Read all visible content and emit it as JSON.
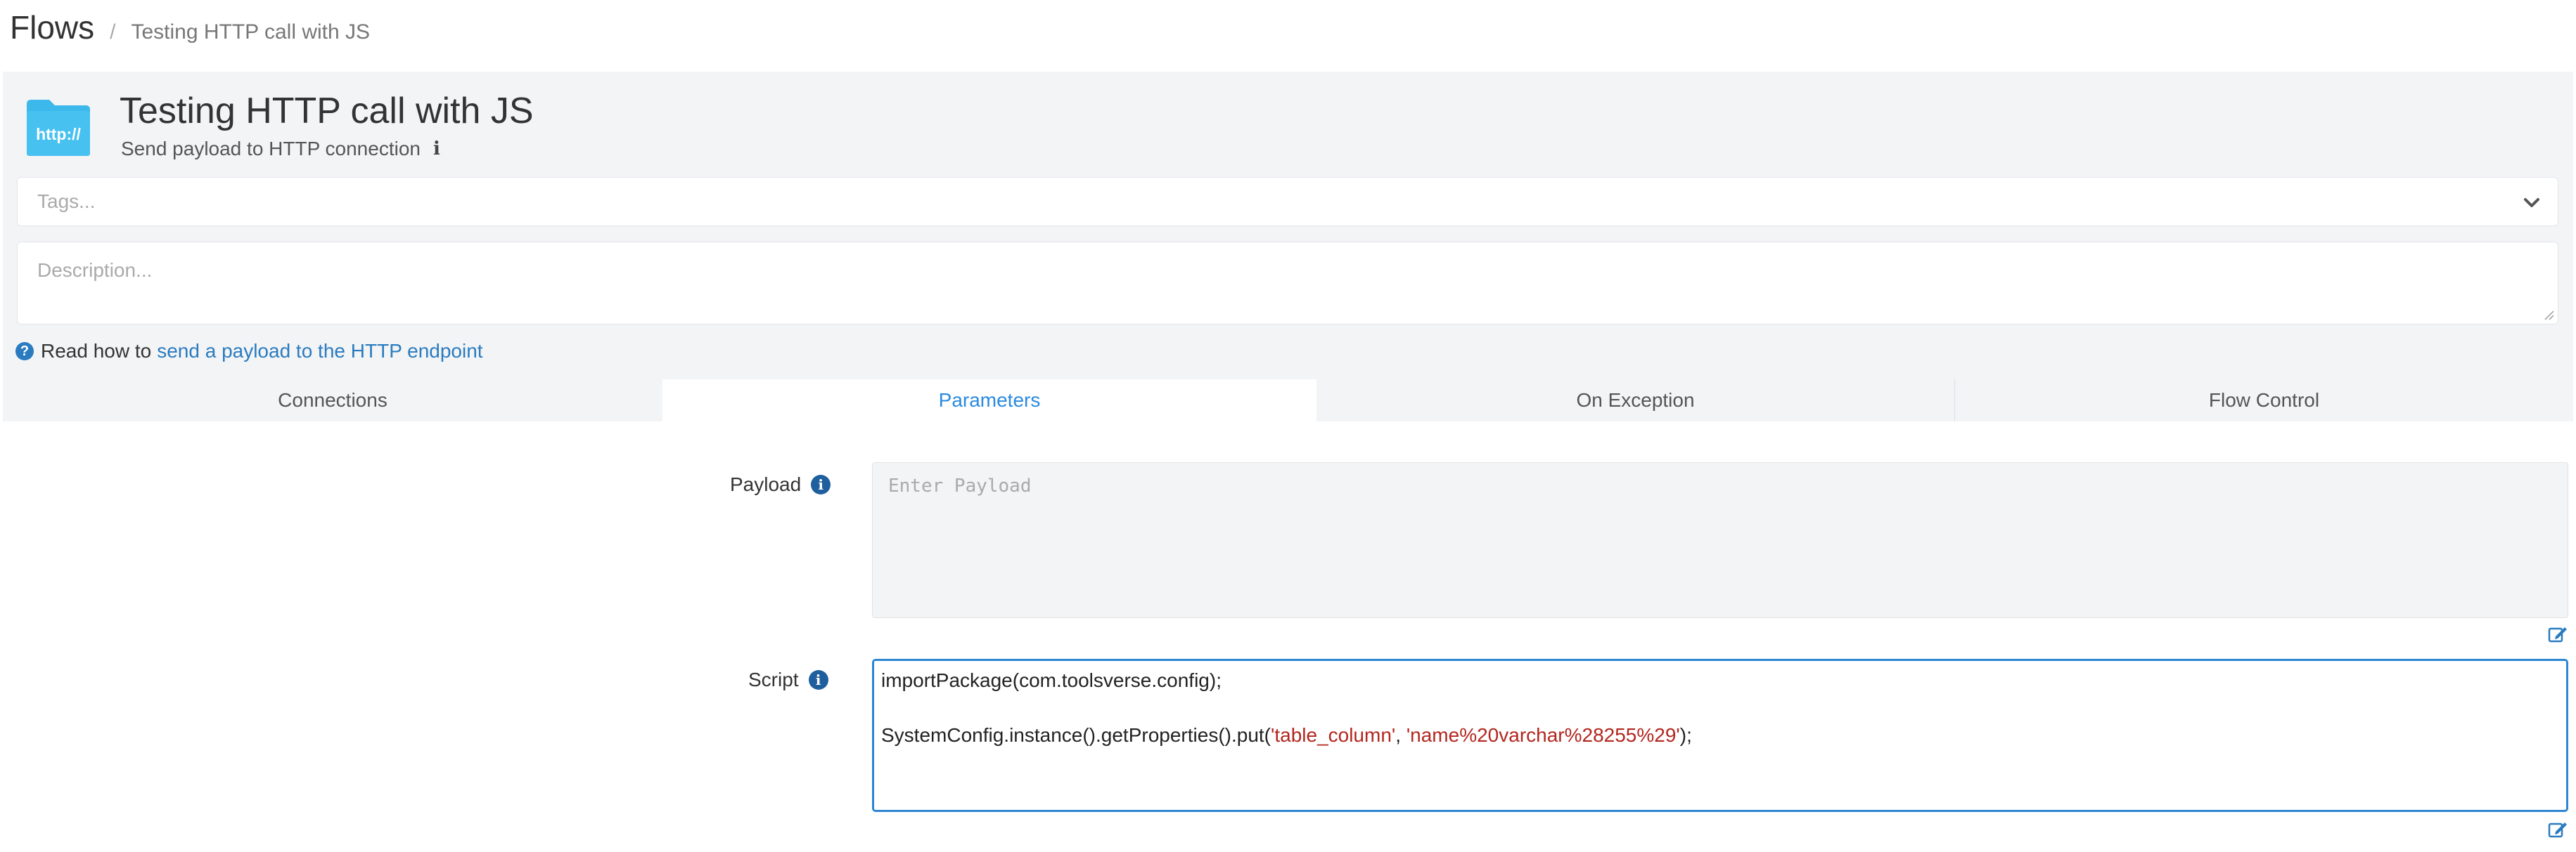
{
  "breadcrumb": {
    "root": "Flows",
    "separator": "/",
    "current": "Testing HTTP call with JS"
  },
  "flow": {
    "icon_label": "http://",
    "title": "Testing HTTP call with JS",
    "subtitle": "Send payload to HTTP connection",
    "info_icon": "i"
  },
  "tags": {
    "placeholder": "Tags..."
  },
  "description": {
    "placeholder": "Description..."
  },
  "help": {
    "icon": "?",
    "prefix": "Read how to",
    "link_text": "send a payload to the HTTP endpoint"
  },
  "tabs": [
    {
      "label": "Connections",
      "active": false
    },
    {
      "label": "Parameters",
      "active": true
    },
    {
      "label": "On Exception",
      "active": false
    },
    {
      "label": "Flow Control",
      "active": false
    }
  ],
  "form": {
    "payload": {
      "label": "Payload",
      "info_icon": "i",
      "placeholder": "Enter Payload",
      "value": ""
    },
    "script": {
      "label": "Script",
      "info_icon": "i",
      "line1": "importPackage(com.toolsverse.config);",
      "line2_prefix": "SystemConfig.instance().getProperties().put(",
      "line2_str1": "'table_column'",
      "line2_comma": ", ",
      "line2_str2": "'name%20varchar%28255%29'",
      "line2_suffix": ");"
    }
  },
  "colors": {
    "accent": "#2a8ae0",
    "link": "#2a7bbf",
    "panel_bg": "#f3f4f6",
    "icon_folder": "#3db8ea",
    "info_dark": "#1f5f9e",
    "code_string": "#b3261e"
  },
  "icons": {
    "folder": "folder-http-icon",
    "chevron": "chevron-down-icon",
    "question": "question-circle-icon",
    "info": "info-circle-icon",
    "edit": "edit-icon",
    "resize": "resize-grip-icon"
  }
}
